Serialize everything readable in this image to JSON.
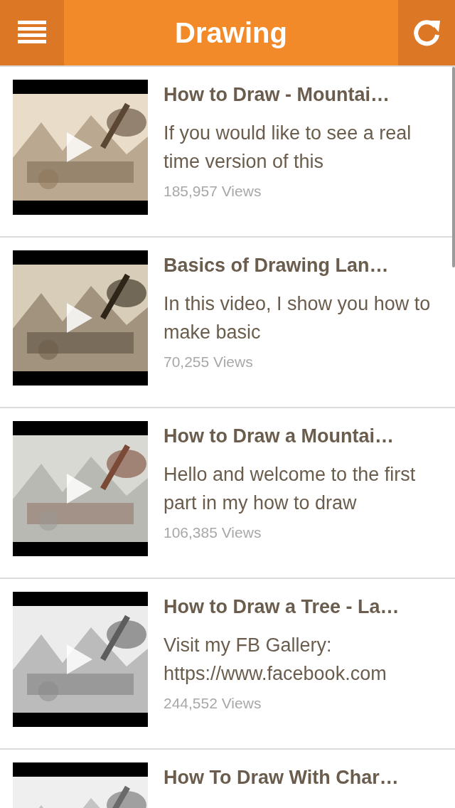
{
  "header": {
    "title": "Drawing"
  },
  "videos": [
    {
      "title": "How to Draw - Mountai…",
      "description": "If you would like to see a real time version of this",
      "views": "185,957 Views",
      "kind": "picture"
    },
    {
      "title": "Basics of Drawing Lan…",
      "description": "In this video, I show you how to make basic",
      "views": "70,255 Views",
      "kind": "picture"
    },
    {
      "title": "How to Draw a Mountai…",
      "description": "Hello and welcome to the first part in my how to draw",
      "views": "106,385 Views",
      "kind": "picture"
    },
    {
      "title": "How to Draw a Tree - La…",
      "description": "Visit my FB Gallery: https://www.facebook.com",
      "views": "244,552 Views",
      "kind": "picture"
    },
    {
      "title": "How To Draw With Char…",
      "kind": "picture"
    }
  ]
}
